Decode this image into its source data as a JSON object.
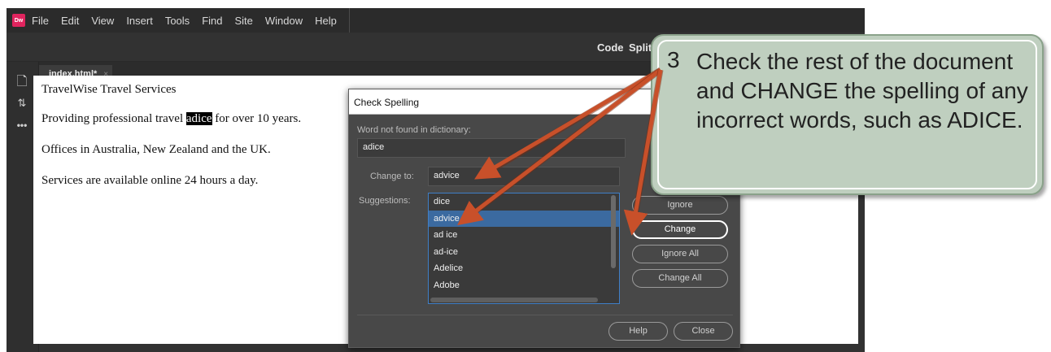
{
  "app": {
    "logo": "Dw",
    "menu": [
      "File",
      "Edit",
      "View",
      "Insert",
      "Tools",
      "Find",
      "Site",
      "Window",
      "Help"
    ],
    "view_buttons": {
      "code": "Code",
      "split": "Split"
    },
    "doc_tab": {
      "label": "index.html*",
      "close": "×"
    },
    "sidebar_icons": [
      "file-icon",
      "sort-icon",
      "more-icon"
    ],
    "sidebar_glyphs": [
      "🗋",
      "⇅",
      "•••"
    ]
  },
  "document": {
    "lines": [
      "TravelWise Travel Services",
      "Providing professional travel ",
      " for over 10 years.",
      "Offices in Australia, New Zealand and the UK.",
      "Services are available online 24 hours a day."
    ],
    "highlighted_word": "adice"
  },
  "dialog": {
    "title": "Check Spelling",
    "not_found_label": "Word not found in dictionary:",
    "not_found_word": "adice",
    "change_to_label": "Change to:",
    "change_to_value": "advice",
    "suggestions_label": "Suggestions:",
    "suggestions": [
      "dice",
      "advice",
      "ad ice",
      "ad-ice",
      "Adelice",
      "Adobe"
    ],
    "selected_suggestion": "advice",
    "buttons": {
      "ignore": "Ignore",
      "change": "Change",
      "ignore_all": "Ignore All",
      "change_all": "Change All",
      "help": "Help",
      "close": "Close"
    }
  },
  "callout": {
    "number": "3",
    "text": "Check the rest of the document and CHANGE the spelling of any incorrect words, such as ADICE."
  },
  "colors": {
    "arrow": "#c8502a",
    "callout_bg": "#bfcfbf",
    "selection": "#3b6aa0"
  }
}
